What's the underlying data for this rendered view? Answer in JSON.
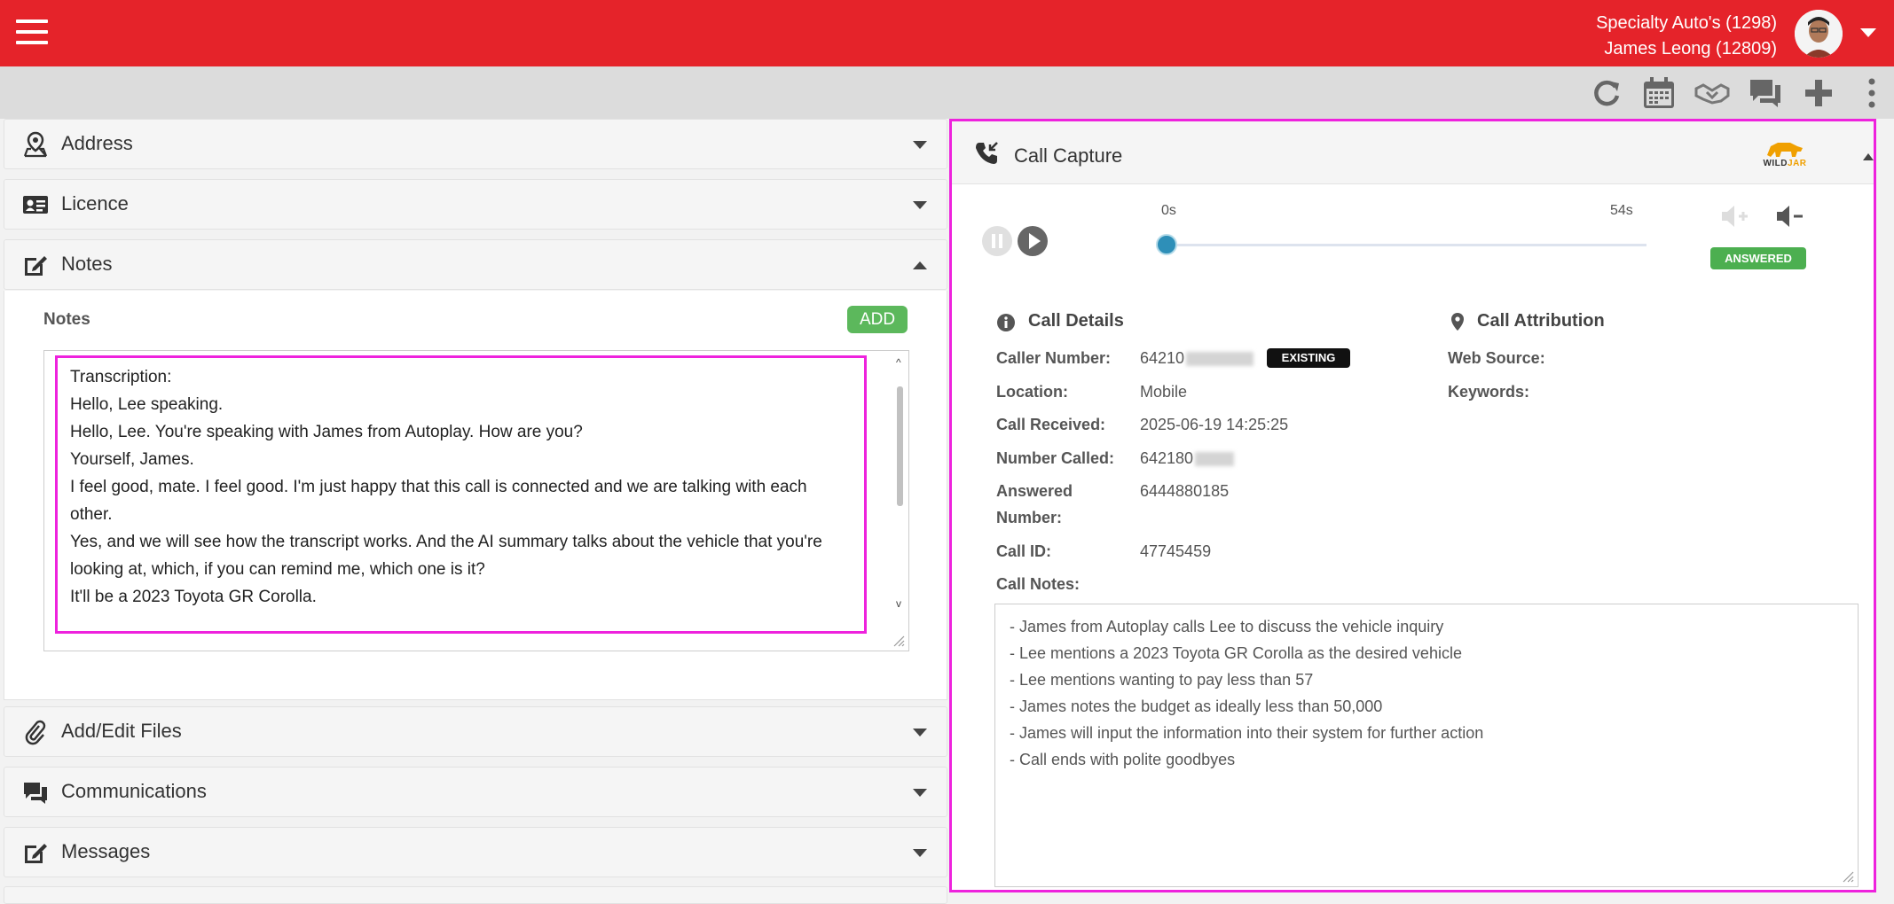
{
  "header": {
    "account_line1": "Specialty Auto's (1298)",
    "account_line2": "James Leong (12809)"
  },
  "toolbar": {
    "icons": [
      "refresh-icon",
      "calendar-icon",
      "handshake-icon",
      "chat-icon",
      "plus-icon",
      "more-vertical-icon"
    ]
  },
  "sections": {
    "address": "Address",
    "licence": "Licence",
    "notes": "Notes",
    "files": "Add/Edit Files",
    "communications": "Communications",
    "messages": "Messages"
  },
  "notes": {
    "label": "Notes",
    "add_label": "ADD",
    "transcript_lines": [
      "Transcription:",
      "Hello, Lee speaking.",
      "Hello, Lee. You're speaking with James from Autoplay. How are you?",
      "Yourself, James.",
      "I feel good, mate. I feel good. I'm just happy that this call is connected and we are talking with each other.",
      "Yes, and we will see how the transcript works. And the AI summary talks about the vehicle that you're looking at, which, if you can remind me, which one is it?",
      "It'll be a 2023 Toyota GR Corolla."
    ]
  },
  "call_capture": {
    "title": "Call Capture",
    "logo_wild": "WILD",
    "logo_jar": "JAR",
    "player": {
      "start_time": "0s",
      "end_time": "54s",
      "progress": 0.0
    },
    "status": "ANSWERED",
    "details_title": "Call Details",
    "attribution_title": "Call Attribution",
    "details": {
      "caller_number_label": "Caller Number:",
      "caller_number_value": "64210",
      "existing_badge": "EXISTING",
      "location_label": "Location:",
      "location_value": "Mobile",
      "received_label": "Call Received:",
      "received_value": "2025-06-19 14:25:25",
      "called_label": "Number Called:",
      "called_value": "642180",
      "answered_label_1": "Answered",
      "answered_label_2": "Number:",
      "answered_value": "6444880185",
      "call_id_label": "Call ID:",
      "call_id_value": "47745459",
      "call_notes_label": "Call Notes:"
    },
    "attribution": {
      "web_source_label": "Web Source:",
      "keywords_label": "Keywords:"
    },
    "call_notes": [
      "- James from Autoplay calls Lee to discuss the vehicle inquiry",
      "- Lee mentions a 2023 Toyota GR Corolla as the desired vehicle",
      "- Lee mentions wanting to pay less than 57",
      "- James notes the budget as ideally less than 50,000",
      "- James will input the information into their system for further action",
      "- Call ends with polite goodbyes"
    ]
  },
  "colors": {
    "brand_red": "#e5232a",
    "highlight": "#ee22dd",
    "success": "#5cb85c",
    "player_blue": "#2e8fb8"
  }
}
